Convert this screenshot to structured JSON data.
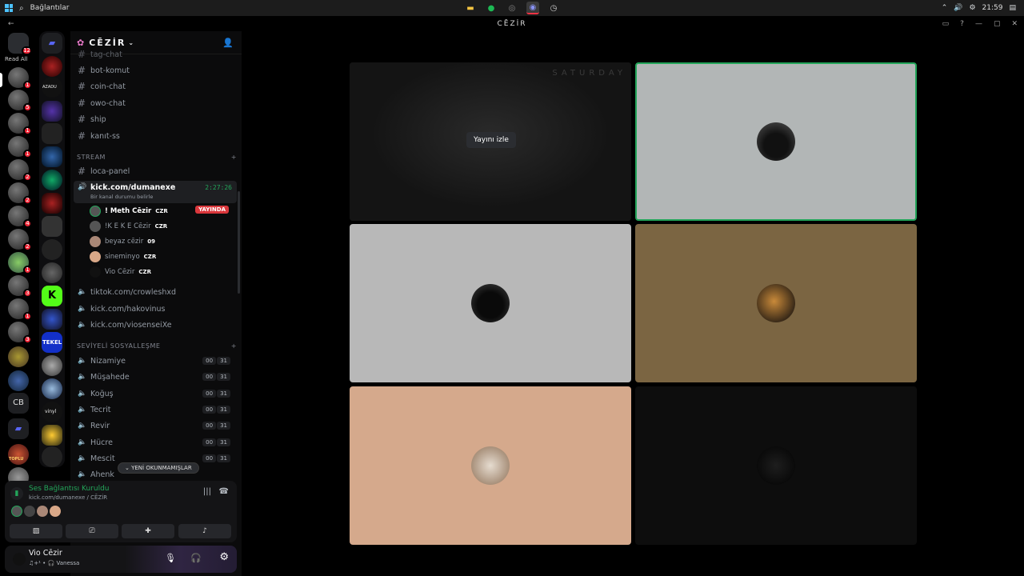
{
  "taskbar": {
    "search_label": "Bağlantılar",
    "clock": "21:59"
  },
  "window": {
    "title": "CĒZİR"
  },
  "servers": {
    "read_all": "Read All",
    "top_badge": "12",
    "badges": [
      "1",
      "5",
      "1",
      "1",
      "2",
      "2",
      "4",
      "2",
      "1",
      "3",
      "1",
      "3"
    ],
    "cb_label": "CB",
    "vinyl_label": "vinyl",
    "tekel_label": "TEKEL",
    "azad_label": "AZADU",
    "bottom_label": "TOPLU"
  },
  "guild": {
    "name": "CĒZİR"
  },
  "channels": {
    "top": [
      "tag-chat",
      "bot-komut",
      "coin-chat",
      "owo-chat",
      "ship",
      "kanıt-ss"
    ],
    "stream_category": "STREAM",
    "loca": "loca-panel",
    "active_voice": {
      "name": "kick.com/dumanexe",
      "timer": "2:27:26",
      "status": "Bir kanal durumu belirle"
    },
    "voice_users": [
      {
        "name": "! Meth Cēzir",
        "tag": "CZR",
        "live": "YAYINDA"
      },
      {
        "name": "!K E K E Cēzir",
        "tag": "CZR"
      },
      {
        "name": "beyaz cēzir",
        "tag": "09"
      },
      {
        "name": "sineminyo",
        "tag": "CZR"
      },
      {
        "name": "Vio Cēzir",
        "tag": "CZR"
      }
    ],
    "other_voice": [
      "tiktok.com/crowleshxd",
      "kick.com/hakovinus",
      "kick.com/viosenseiXe"
    ],
    "social_category": "SEVİYELİ SOSYALLEŞME",
    "social": [
      {
        "name": "Nizamiye",
        "a": "00",
        "b": "31"
      },
      {
        "name": "Müşahede",
        "a": "00",
        "b": "31"
      },
      {
        "name": "Koğuş",
        "a": "00",
        "b": "31"
      },
      {
        "name": "Tecrit",
        "a": "00",
        "b": "31"
      },
      {
        "name": "Revir",
        "a": "00",
        "b": "31"
      },
      {
        "name": "Hücre",
        "a": "00",
        "b": "31"
      },
      {
        "name": "Mescit",
        "a": "00",
        "b": "31"
      },
      {
        "name": "Ahenk",
        "a": "",
        "b": ""
      }
    ],
    "unread_label": "YENİ OKUNMAMIŞLAR"
  },
  "voice_connection": {
    "status": "Ses Bağlantısı Kuruldu",
    "channel": "kick.com/dumanexe / CĒZİR"
  },
  "user": {
    "name": "Vio Cēzir",
    "status": "♫+¹ • 🎧 Vanessa"
  },
  "stage": {
    "watch_label": "Yayını izle",
    "stream_title": "SATURDAY"
  },
  "colors": {
    "accent": "#23a55a",
    "live": "#da373c",
    "brand": "#5865f2"
  }
}
